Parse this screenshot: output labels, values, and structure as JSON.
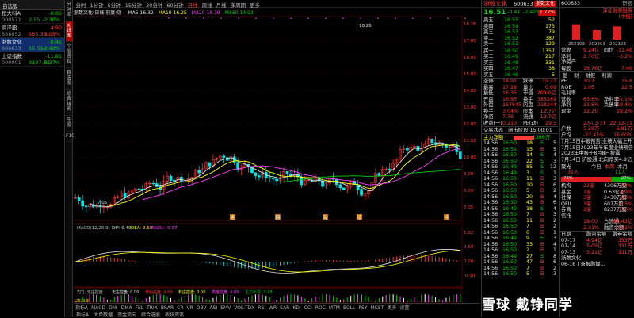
{
  "watchlist": {
    "header": "自选股",
    "items": [
      {
        "name": "恒大科A",
        "code": "000571",
        "price": "2.55",
        "chg": "-0.06",
        "pct": "-2.30%",
        "up": false
      },
      {
        "name": "润泽股",
        "code": "688052",
        "price": "165.33",
        "chg": "4.90",
        "pct": "3.05%",
        "up": true
      },
      {
        "name": "浙数文化",
        "code": "600633",
        "price": "16.51",
        "chg": "-0.41",
        "pct": "-2.42%",
        "up": false,
        "selected": true
      },
      {
        "name": "上证指数",
        "code": "000001",
        "price": "3197.62",
        "chg": "-11.81",
        "pct": "-0.37%",
        "up": false
      }
    ]
  },
  "vbar": [
    "分时图",
    "K线图",
    "个股资料",
    "自选股",
    "综合排名",
    "牛股",
    "F10"
  ],
  "tabs": [
    "分时",
    "1分钟",
    "5分钟",
    "15分钟",
    "30分钟",
    "60分钟",
    "日线",
    "周线",
    "月线",
    "多周期",
    "更多"
  ],
  "active_tab": "日线",
  "mabar": {
    "name": "浙数文化(日线 前复权)",
    "items": [
      {
        "label": "MA5 16.32",
        "color": "#e0e0e0"
      },
      {
        "label": "MA10 16.25",
        "color": "#ffff00"
      },
      {
        "label": "MA20 15.19",
        "color": "#ff40ff"
      },
      {
        "label": "MA60 14.92",
        "color": "#00d000"
      }
    ]
  },
  "price_axis": [
    "18.26",
    "17.00",
    "16.00",
    "15.00",
    "14.00",
    "13.00",
    "12.00",
    "11.00",
    "10.00",
    "9.00",
    "8.00",
    "7.05"
  ],
  "kline": {
    "high_label": "18.26",
    "low_label": "7.05",
    "events": [
      "建",
      "拥",
      "买",
      "增",
      "特"
    ]
  },
  "macd_bar": {
    "label": "MACD(12,26,9)",
    "items": [
      {
        "label": "DIF: 0.49",
        "color": "#e0e0e0"
      },
      {
        "label": "DEA: 0.53",
        "color": "#ffff00"
      },
      {
        "label": "MACD: -0.07",
        "color": "#ff40ff"
      }
    ]
  },
  "macd_axis": [
    "1.02",
    "0.50",
    "0.00",
    "-0.50"
  ],
  "zjtj_bar": {
    "label": "ZJTJ: 无庄控盘",
    "items": [
      {
        "label": "无庄控盘: 0.00",
        "color": "#e0e0e0"
      },
      {
        "label": "开始控盘: 0.00",
        "color": "#ff3b3b"
      },
      {
        "label": "有庄控盘: 0.00",
        "color": "#ffff00"
      },
      {
        "label": "高度控盘: 0.00",
        "color": "#ff40ff"
      },
      {
        "label": "主力出货: 3.78",
        "color": "#00d000"
      }
    ]
  },
  "zjtj_axis": [
    "100.00",
    "80.00",
    "60.00",
    "40.00",
    "20.00",
    "0.00"
  ],
  "bottom_tabs": [
    "指标A",
    "MACD",
    "DMI",
    "DMA",
    "FSL",
    "TRIX",
    "BRAR",
    "CR",
    "VR",
    "OBV",
    "ASI",
    "EMV",
    "VOL-TDX",
    "RSI",
    "WR",
    "SAR",
    "KDJ",
    "CCI",
    "ROC",
    "MTM",
    "BOLL",
    "PSY",
    "MCST",
    "更多",
    "设置"
  ],
  "bottom_tabs2": [
    "指标A",
    "大单数据",
    "资金流向",
    "综合选股",
    "板块资讯"
  ],
  "year_label": "2023年",
  "quote": {
    "name": "浙数文化",
    "code": "600633",
    "price": "16.51",
    "chg": "-0.41",
    "pct": "-2.42%",
    "tag": "浙数文化",
    "rate": "1.72%",
    "sell": [
      {
        "l": "卖五",
        "p": "16.55",
        "v": "52"
      },
      {
        "l": "卖四",
        "p": "16.54",
        "v": "173"
      },
      {
        "l": "卖三",
        "p": "16.53",
        "v": "79"
      },
      {
        "l": "卖二",
        "p": "16.52",
        "v": "387"
      },
      {
        "l": "卖一",
        "p": "16.51",
        "v": "129"
      }
    ],
    "buy": [
      {
        "l": "买一",
        "p": "16.50",
        "v": "1357"
      },
      {
        "l": "买二",
        "p": "16.49",
        "v": "217"
      },
      {
        "l": "买三",
        "p": "16.48",
        "v": "331"
      },
      {
        "l": "买四",
        "p": "16.47",
        "v": "38"
      },
      {
        "l": "买五",
        "p": "16.46",
        "v": "5"
      }
    ],
    "stats": [
      {
        "a": "涨停",
        "b": "18.91",
        "c": "跌停",
        "d": "15.23"
      },
      {
        "a": "最高",
        "b": "17.28",
        "c": "量比",
        "d": "0.69"
      },
      {
        "a": "最低",
        "b": "16.35",
        "c": "市值",
        "d": "209.0亿"
      },
      {
        "a": "开盘",
        "b": "16.93",
        "c": "换手",
        "d": "385289"
      },
      {
        "a": "外盘",
        "b": "167845",
        "c": "内盘",
        "d": "218244"
      },
      {
        "a": "换手",
        "b": "3.04%",
        "c": "股本",
        "d": "12.7亿"
      },
      {
        "a": "净资",
        "b": "7.76",
        "c": "流通",
        "d": "12.7亿"
      },
      {
        "a": "收益(一)",
        "b": "0.210",
        "c": "PE(动)",
        "d": "29.5"
      }
    ],
    "trade_header": "交易状态 | 闭市阶段 15:00:01",
    "main_net": "主力净额",
    "main_val": "-1389万",
    "ticks": [
      {
        "t": "14:56",
        "p": "16.50",
        "v": "18",
        "s": "S",
        "n": "5"
      },
      {
        "t": "14:56",
        "p": "16.51",
        "v": "15",
        "s": "B",
        "n": "5"
      },
      {
        "t": "14:56",
        "p": "16.50",
        "v": "14",
        "s": "S",
        "n": "4"
      },
      {
        "t": "14:56",
        "p": "16.50",
        "v": "22",
        "s": "S",
        "n": "3"
      },
      {
        "t": "14:56",
        "p": "16.49",
        "v": "85",
        "s": "S",
        "n": "12"
      },
      {
        "t": "14:56",
        "p": "16.49",
        "v": "3",
        "s": "S",
        "n": "1"
      },
      {
        "t": "14:56",
        "p": "16.50",
        "v": "11",
        "s": "B",
        "n": "3"
      },
      {
        "t": "14:56",
        "p": "16.50",
        "v": "10",
        "s": "B",
        "n": "6"
      },
      {
        "t": "14:56",
        "p": "16.50",
        "v": "5",
        "s": "B",
        "n": "2"
      },
      {
        "t": "14:56",
        "p": "16.50",
        "v": "20",
        "s": "B",
        "n": "4"
      },
      {
        "t": "14:56",
        "p": "16.50",
        "v": "43",
        "s": "B",
        "n": "6"
      },
      {
        "t": "14:56",
        "p": "16.49",
        "v": "18",
        "s": "S",
        "n": "4"
      },
      {
        "t": "14:56",
        "p": "16.50",
        "v": "7",
        "s": "B",
        "n": "3"
      },
      {
        "t": "14:56",
        "p": "16.50",
        "v": "11",
        "s": "B",
        "n": "2"
      },
      {
        "t": "14:56",
        "p": "16.50",
        "v": "7",
        "s": "B",
        "n": "2"
      },
      {
        "t": "14:56",
        "p": "16.50",
        "v": "6",
        "s": "B",
        "n": "1"
      },
      {
        "t": "14:56",
        "p": "16.49",
        "v": "9",
        "s": "S",
        "n": "3"
      },
      {
        "t": "14:56",
        "p": "16.50",
        "v": "33",
        "s": "B",
        "n": "4"
      },
      {
        "t": "14:56",
        "p": "16.50",
        "v": "2",
        "s": "B",
        "n": "1"
      },
      {
        "t": "14:56",
        "p": "16.49",
        "v": "27",
        "s": "S",
        "n": "8"
      },
      {
        "t": "14:56",
        "p": "16.50",
        "v": "47",
        "s": "B",
        "n": "6"
      },
      {
        "t": "14:56",
        "p": "16.50",
        "v": "7",
        "s": "B",
        "n": "2"
      },
      {
        "t": "14:56",
        "p": "16.50",
        "v": "5",
        "s": "B",
        "n": "3"
      },
      {
        "t": "14:56",
        "p": "16.49",
        "v": "10",
        "s": "S",
        "n": "6"
      },
      {
        "t": "14:56",
        "p": "16.50",
        "v": "12",
        "s": "B",
        "n": "4"
      },
      {
        "t": "14:56",
        "p": "16.50",
        "v": "275",
        "s": "B",
        "n": "21"
      },
      {
        "t": "14:56",
        "p": "16.51",
        "v": "3",
        "s": "B",
        "n": "1"
      },
      {
        "t": "15:00",
        "p": "16.51",
        "v": "7485",
        "s": "B",
        "n": "326"
      }
    ]
  },
  "fin": {
    "code": "600633",
    "title": "浙数文化",
    "sub": "深证融资融券",
    "subrow": "(中报)",
    "tiny_label": "研报",
    "chart_labels": [
      "202103",
      "202203",
      "202303"
    ],
    "chart_vals": [
      2.9,
      1.8,
      2.5
    ],
    "rows1": [
      {
        "a": "营收",
        "b": "9.24亿",
        "c": "同比",
        "d": "-11.46"
      },
      {
        "a": "净利",
        "b": "2.70亿",
        "c": "",
        "d": "-3.2%"
      },
      {
        "a": "净资产",
        "b": "",
        "c": "",
        "d": ""
      },
      {
        "a": "每股",
        "b": "16.76亿",
        "c": "",
        "d": "7.46"
      }
    ],
    "fin_tabs": [
      "盈",
      "财",
      "财报",
      "利润"
    ],
    "rows2": [
      {
        "a": "PE",
        "b": "30.2",
        "c": "",
        "d": "15.6"
      },
      {
        "a": "ROE",
        "b": "1.05",
        "c": "",
        "d": "22.5"
      },
      {
        "a": "毛利率",
        "b": "",
        "c": "",
        "d": ""
      },
      {
        "a": "营收",
        "b": "63.6%",
        "c": "净利率",
        "d": "51.1%"
      },
      {
        "a": "净利",
        "b": "21.6%",
        "c": "负债率",
        "d": "19.4%"
      },
      {
        "a": "现金",
        "b": "12.2亿",
        "c": "",
        "d": "19.2%"
      },
      {
        "a": "",
        "b": "",
        "c": "",
        "d": ""
      },
      {
        "a": "",
        "b": "23-03-31",
        "c": "",
        "d": "22-12-31"
      },
      {
        "a": "户数",
        "b": "5.28万",
        "c": "",
        "d": "6.81万"
      },
      {
        "a": "户均",
        "b": "-22.45%",
        "c": "",
        "d": "16.60%"
      }
    ],
    "news": [
      "7月15日中报预告:业绩大幅上升",
      "7月15日2023年半年度业绩预告",
      "2023年中报于8月8日披露",
      "7月14日 沪股通:北向净买4.8亿"
    ],
    "ratio_header": "聚光",
    "ratio_tabs": [
      "今日",
      "本周",
      "本月"
    ],
    "ratio_vals": [
      "31人",
      "11人"
    ],
    "bar_left": "73%",
    "bar_right": "27%",
    "holders": [
      {
        "a": "机构",
        "b": "22家",
        "c": "4306万股",
        "d": "3.4%"
      },
      {
        "a": "基金",
        "b": "1家",
        "c": "0.63亿股",
        "d": "4.9%"
      },
      {
        "a": "社保",
        "b": "3家",
        "c": "2430万股",
        "d": "1.9%"
      },
      {
        "a": "QFII",
        "b": "3家",
        "c": "607万股",
        "d": "0.5%"
      },
      {
        "a": "券商",
        "b": "1家",
        "c": "8237万股",
        "d": "0.6%"
      },
      {
        "a": "信托",
        "b": "",
        "c": "",
        "d": ""
      },
      {
        "a": "",
        "b": "18.00",
        "c": "占流通",
        "d": "66.43亿"
      },
      {
        "a": "",
        "b": "2.31%",
        "c": "融资余额",
        "d": "2.21%"
      }
    ],
    "margin": [
      {
        "a": "日期",
        "b": "融资余额",
        "c": "融券余额"
      },
      {
        "a": "07-17",
        "b": "4.94亿",
        "c": "353万"
      },
      {
        "a": "07-14",
        "b": "5.09亿",
        "c": "331万"
      },
      {
        "a": "07-13",
        "b": "5.21亿",
        "c": "331万"
      }
    ],
    "footer": "浙数文化:",
    "footer2": "06-16 | 浙报融媒..."
  },
  "watermark": "雪球 戴铮同学"
}
